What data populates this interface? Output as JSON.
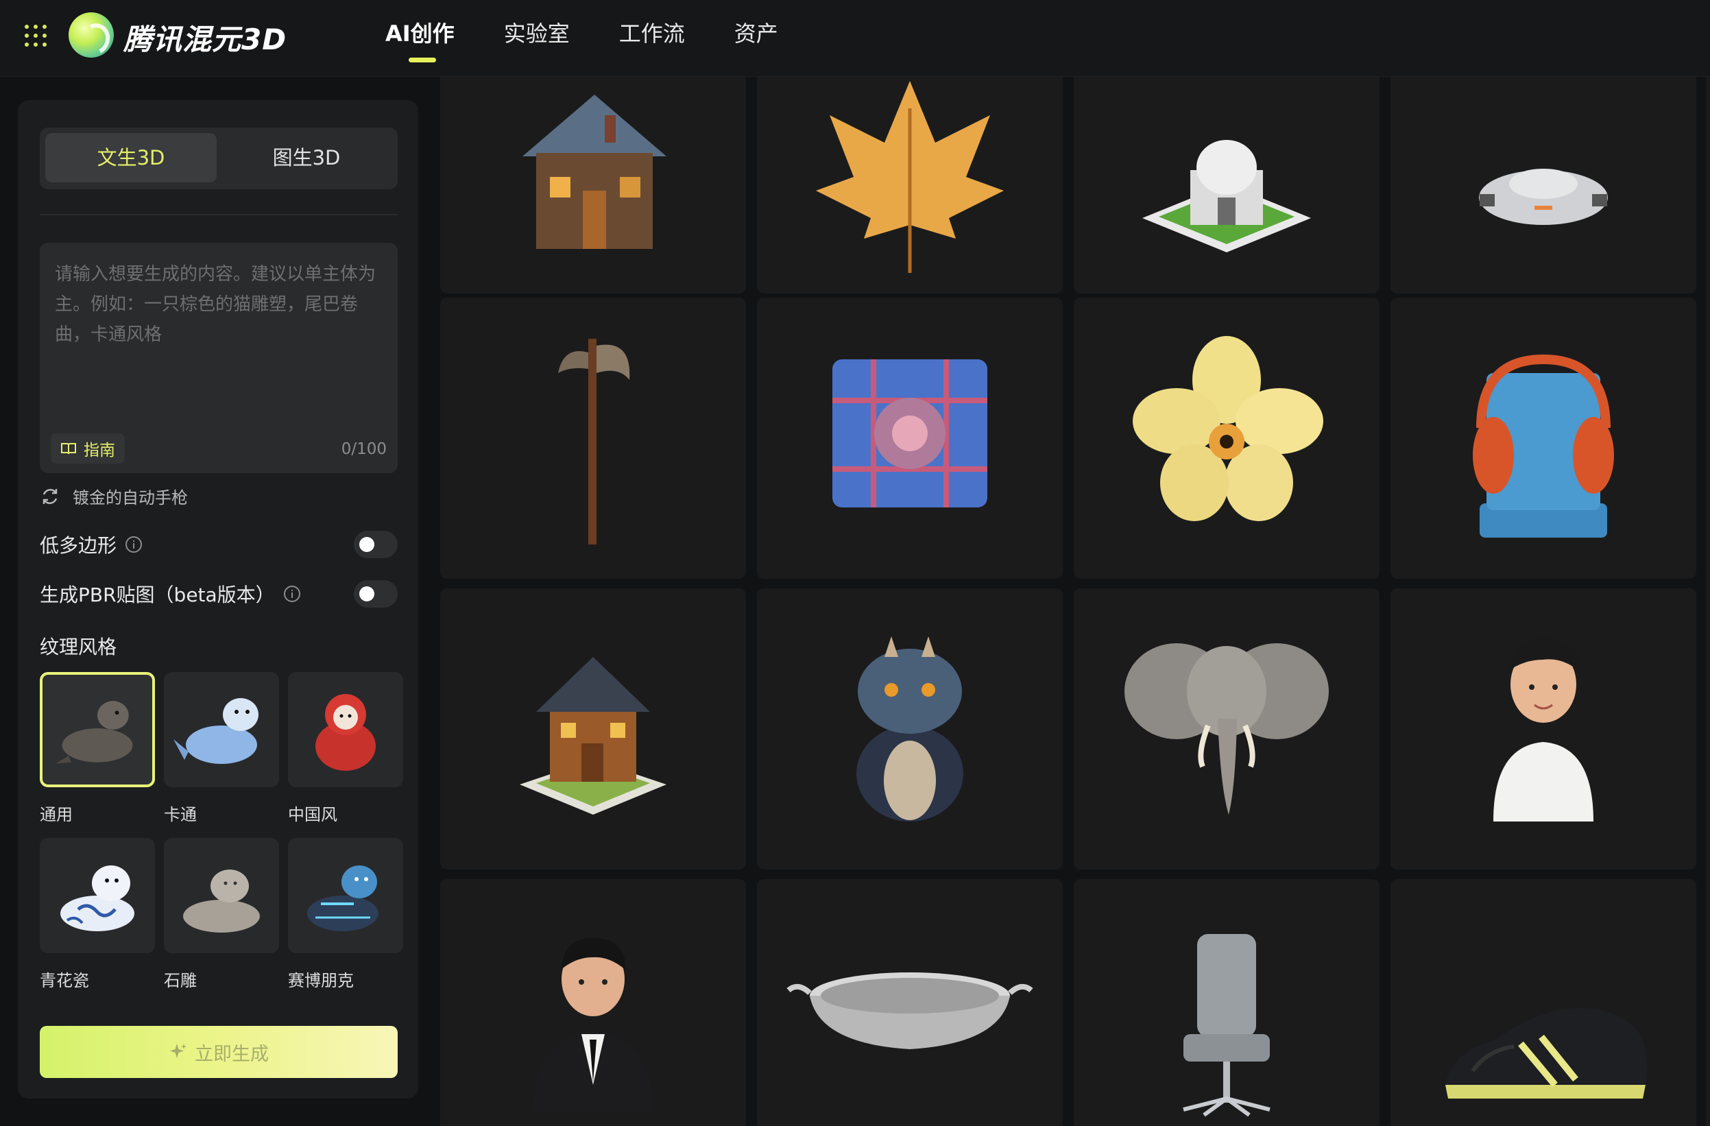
{
  "app": {
    "name": "腾讯混元3D",
    "accent_color": "#e6f25a",
    "apps_icon": "grid-dots-icon"
  },
  "nav": {
    "items": [
      {
        "label": "AI创作",
        "active": true
      },
      {
        "label": "实验室",
        "active": false
      },
      {
        "label": "工作流",
        "active": false
      },
      {
        "label": "资产",
        "active": false
      }
    ]
  },
  "panel": {
    "mode_tabs": [
      {
        "label": "文生3D",
        "active": true
      },
      {
        "label": "图生3D",
        "active": false
      }
    ],
    "prompt": {
      "value": "",
      "placeholder": "请输入想要生成的内容。建议以单主体为主。例如：一只棕色的猫雕塑，尾巴卷曲，卡通风格",
      "counter": "0/100"
    },
    "guide_label": "指南",
    "sample_prompt": "镀金的自动手枪",
    "options": [
      {
        "label": "低多边形",
        "enabled": false
      },
      {
        "label": "生成PBR贴图（beta版本）",
        "enabled": false
      }
    ],
    "texture_title": "纹理风格",
    "styles": [
      {
        "label": "通用",
        "selected": true,
        "color": "#6b655f"
      },
      {
        "label": "卡通",
        "selected": false,
        "color": "#8fb6e6"
      },
      {
        "label": "中国风",
        "selected": false,
        "color": "#c8322c"
      },
      {
        "label": "青花瓷",
        "selected": false,
        "color": "#e8eef8"
      },
      {
        "label": "石雕",
        "selected": false,
        "color": "#a8a198"
      },
      {
        "label": "赛博朋克",
        "selected": false,
        "color": "#4a90c8"
      }
    ],
    "generate_label": "立即生成"
  },
  "gallery": {
    "items": [
      {
        "name": "wooden-house",
        "icon": "house-icon"
      },
      {
        "name": "maple-leaf",
        "icon": "leaf-icon"
      },
      {
        "name": "white-temple",
        "icon": "temple-icon"
      },
      {
        "name": "spaceship",
        "icon": "spaceship-icon"
      },
      {
        "name": "battle-axe",
        "icon": "axe-icon"
      },
      {
        "name": "plaid-pillow",
        "icon": "pillow-icon"
      },
      {
        "name": "yellow-flower",
        "icon": "flower-icon"
      },
      {
        "name": "headphones-stand",
        "icon": "headphones-icon"
      },
      {
        "name": "cottage",
        "icon": "cottage-icon"
      },
      {
        "name": "blue-dragon",
        "icon": "dragon-icon"
      },
      {
        "name": "elephant-head",
        "icon": "elephant-icon"
      },
      {
        "name": "boy-figure",
        "icon": "boy-icon"
      },
      {
        "name": "suited-man",
        "icon": "man-icon"
      },
      {
        "name": "steel-pan",
        "icon": "pan-icon"
      },
      {
        "name": "office-chair",
        "icon": "chair-icon"
      },
      {
        "name": "sneaker",
        "icon": "sneaker-icon"
      }
    ]
  }
}
